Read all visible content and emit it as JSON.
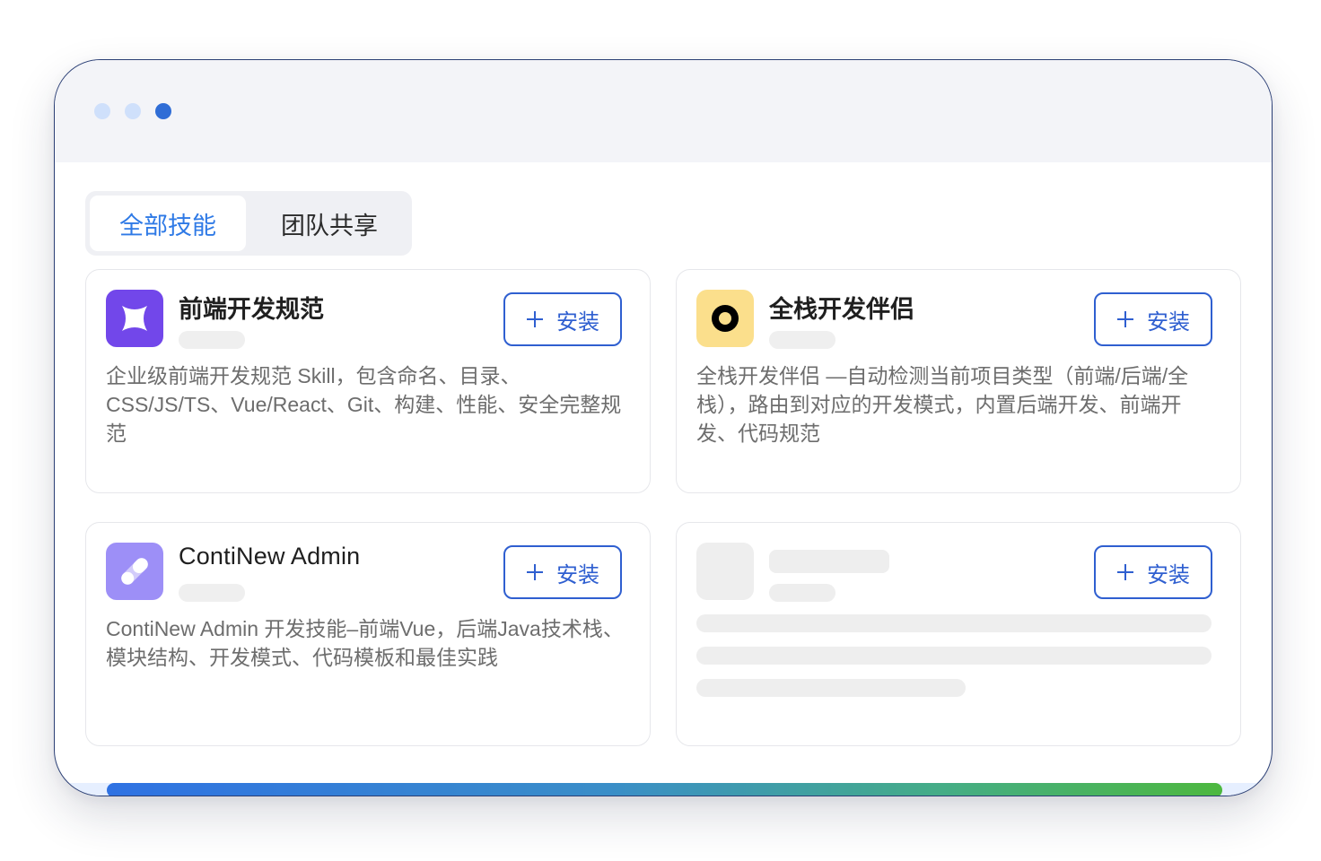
{
  "tabs": [
    {
      "label": "全部技能",
      "active": true
    },
    {
      "label": "团队共享",
      "active": false
    }
  ],
  "install_label": "安装",
  "skills": [
    {
      "title": "前端开发规范",
      "description": "企业级前端开发规范 Skill，包含命名、目录、CSS/JS/TS、Vue/React、Git、构建、性能、安全完整规范",
      "icon": "sparkle-icon",
      "icon_color": "#7247ea"
    },
    {
      "title": "全栈开发伴侣",
      "description": "全栈开发伴侣 —自动检测当前项目类型（前端/后端/全栈），路由到对应的开发模式，内置后端开发、前端开发、代码规范",
      "icon": "ring-icon",
      "icon_color": "#fbdf8c"
    },
    {
      "title": "ContiNew Admin",
      "description": "ContiNew Admin 开发技能–前端Vue，后端Java技术栈、模块结构、开发模式、代码模板和最佳实践",
      "icon": "pill-icon",
      "icon_color": "#9d8ff7"
    }
  ],
  "loading_card": {
    "loading": true
  },
  "colors": {
    "accent": "#2f7ae6",
    "button_border": "#2f5fd0",
    "window_border": "#2b3f75"
  },
  "progress": {
    "fraction": 1.0
  }
}
